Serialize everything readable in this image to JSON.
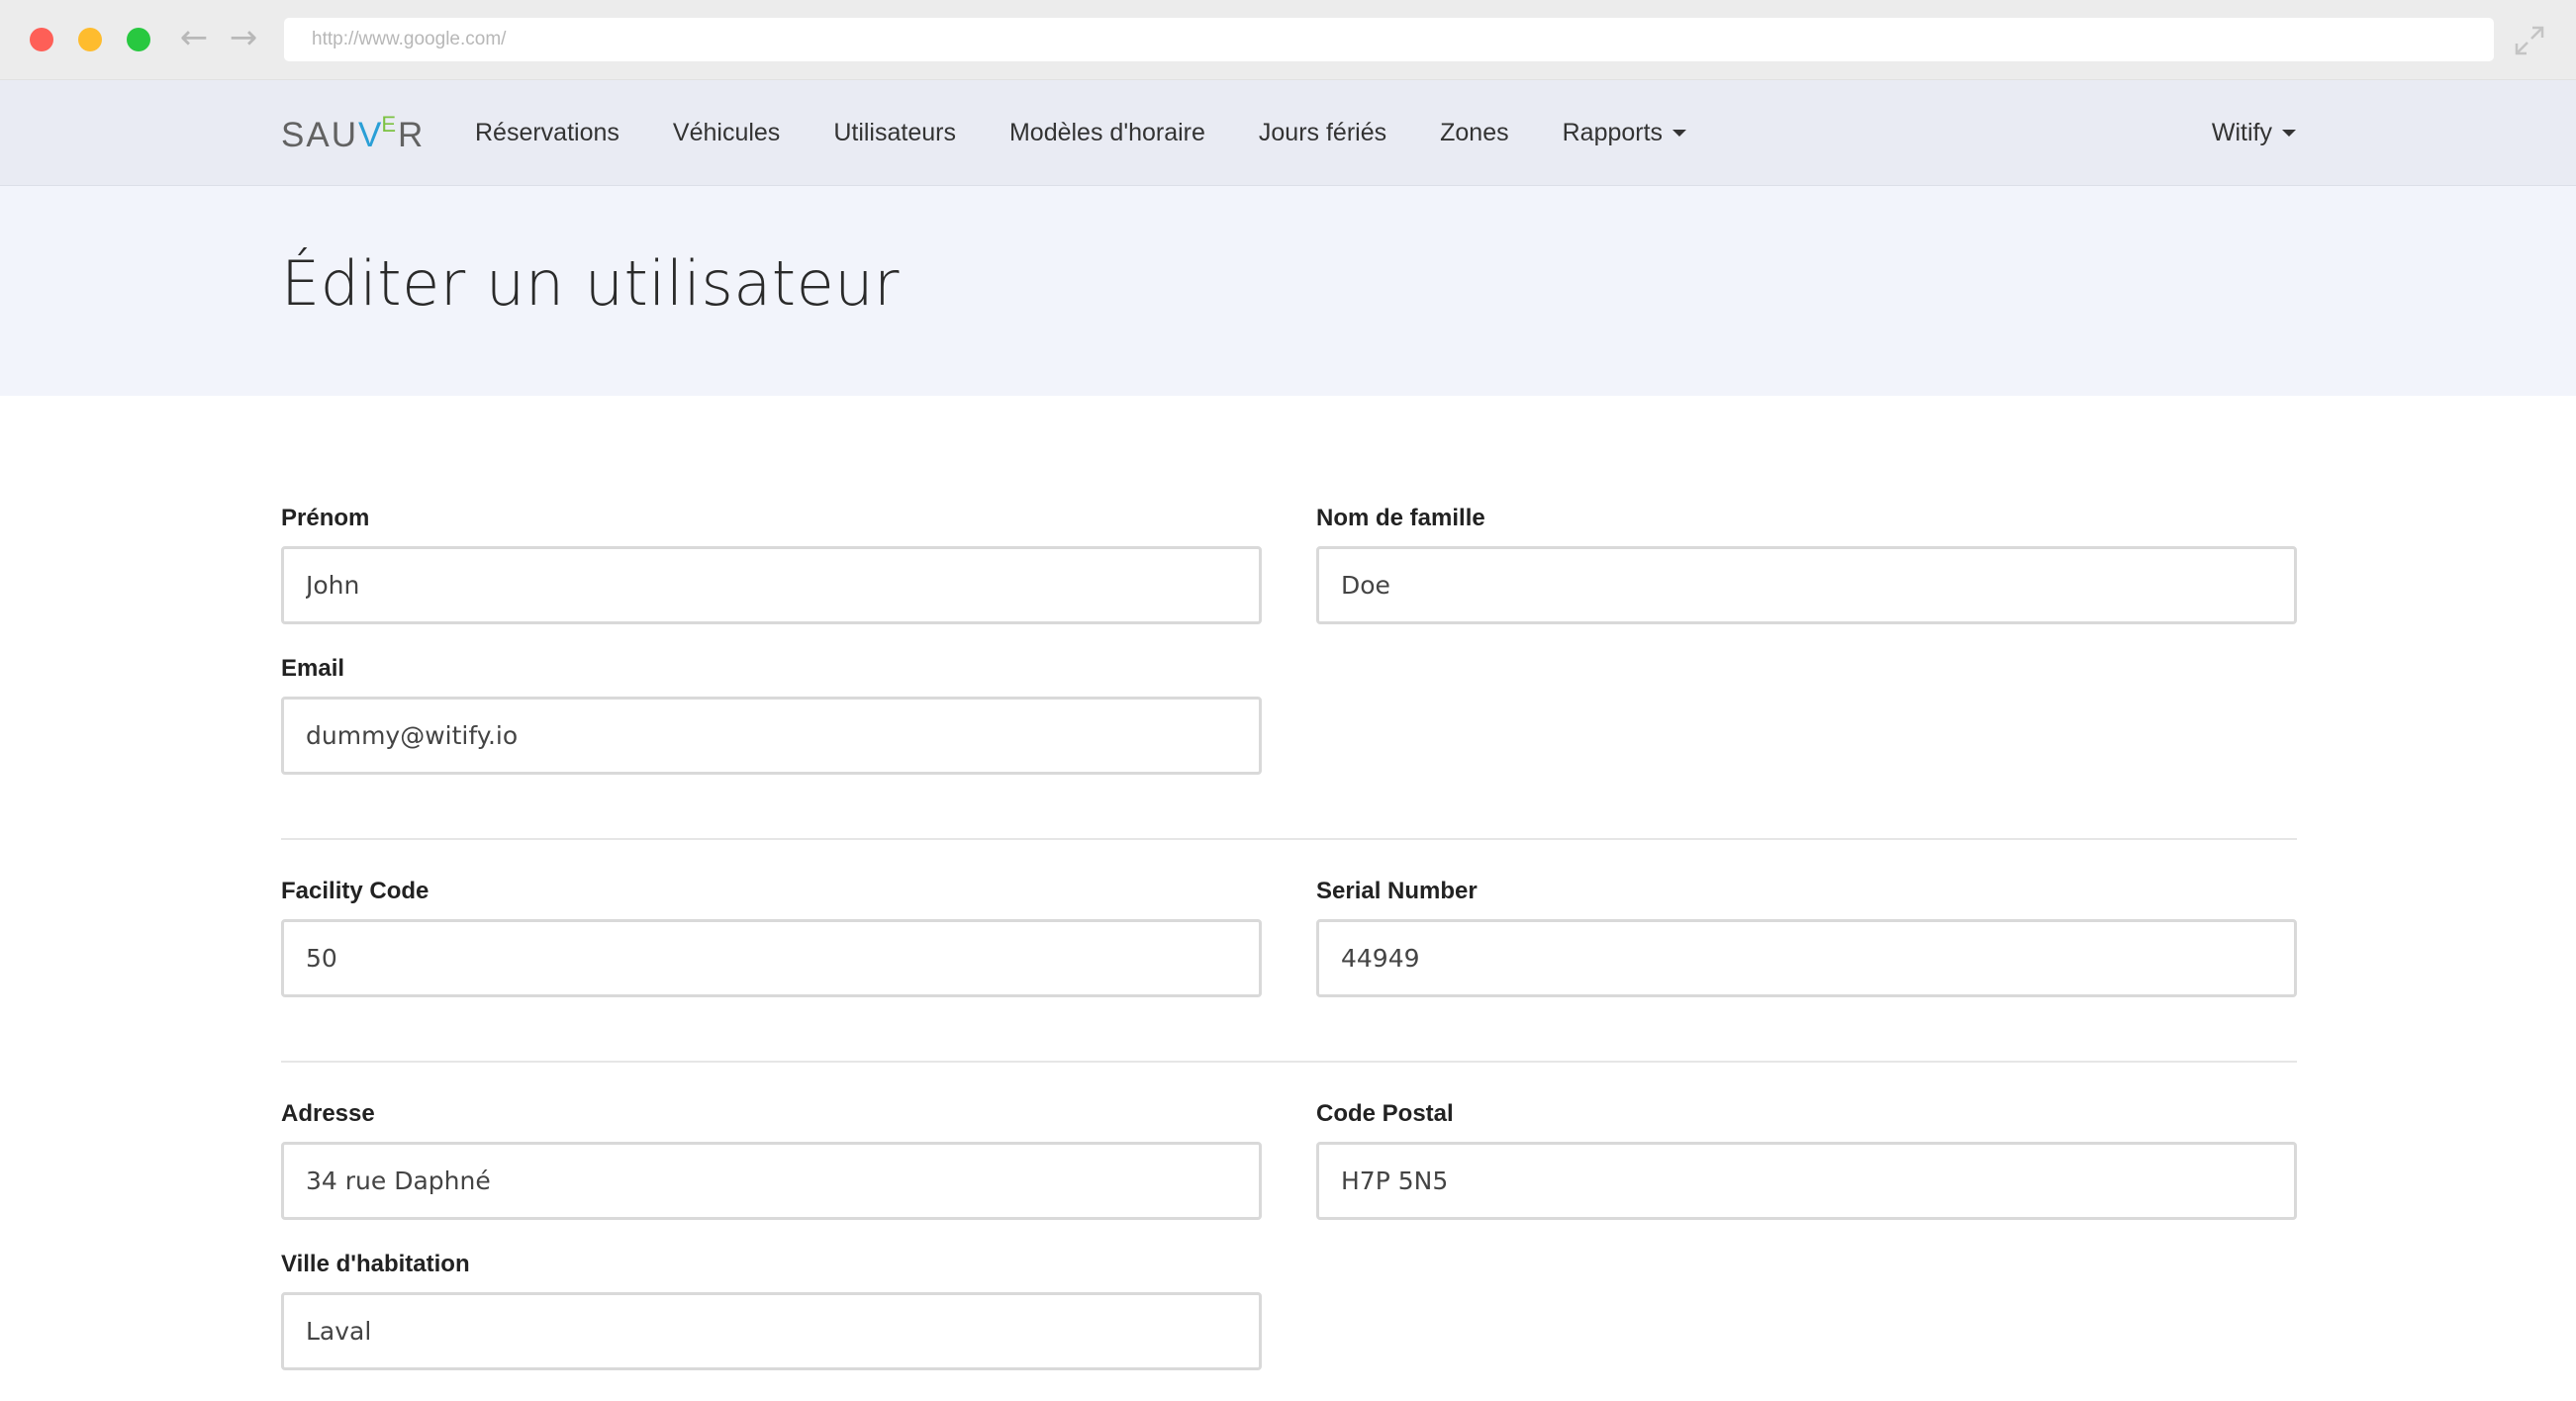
{
  "browser": {
    "url": "http://www.google.com/",
    "back_icon": "arrow-left-icon",
    "forward_icon": "arrow-right-icon",
    "expand_icon": "expand-icon"
  },
  "navbar": {
    "logo_parts": [
      "SAU",
      "V",
      "E",
      "R"
    ],
    "links": [
      "Réservations",
      "Véhicules",
      "Utilisateurs",
      "Modèles d'horaire",
      "Jours fériés",
      "Zones",
      "Rapports"
    ],
    "user": "Witify"
  },
  "page": {
    "title": "Éditer un utilisateur"
  },
  "form": {
    "first_name": {
      "label": "Prénom",
      "value": "John"
    },
    "last_name": {
      "label": "Nom de famille",
      "value": "Doe"
    },
    "email": {
      "label": "Email",
      "value": "dummy@witify.io"
    },
    "facility_code": {
      "label": "Facility Code",
      "value": "50"
    },
    "serial_number": {
      "label": "Serial Number",
      "value": "44949"
    },
    "address": {
      "label": "Adresse",
      "value": "34 rue Daphné"
    },
    "postal_code": {
      "label": "Code Postal",
      "value": "H7P 5N5"
    },
    "city": {
      "label": "Ville d'habitation",
      "value": "Laval"
    }
  },
  "colors": {
    "navbar_bg": "#e9ebf3",
    "header_bg": "#f2f4fb",
    "logo_v": "#2a9fd6",
    "logo_e": "#7cc242"
  }
}
